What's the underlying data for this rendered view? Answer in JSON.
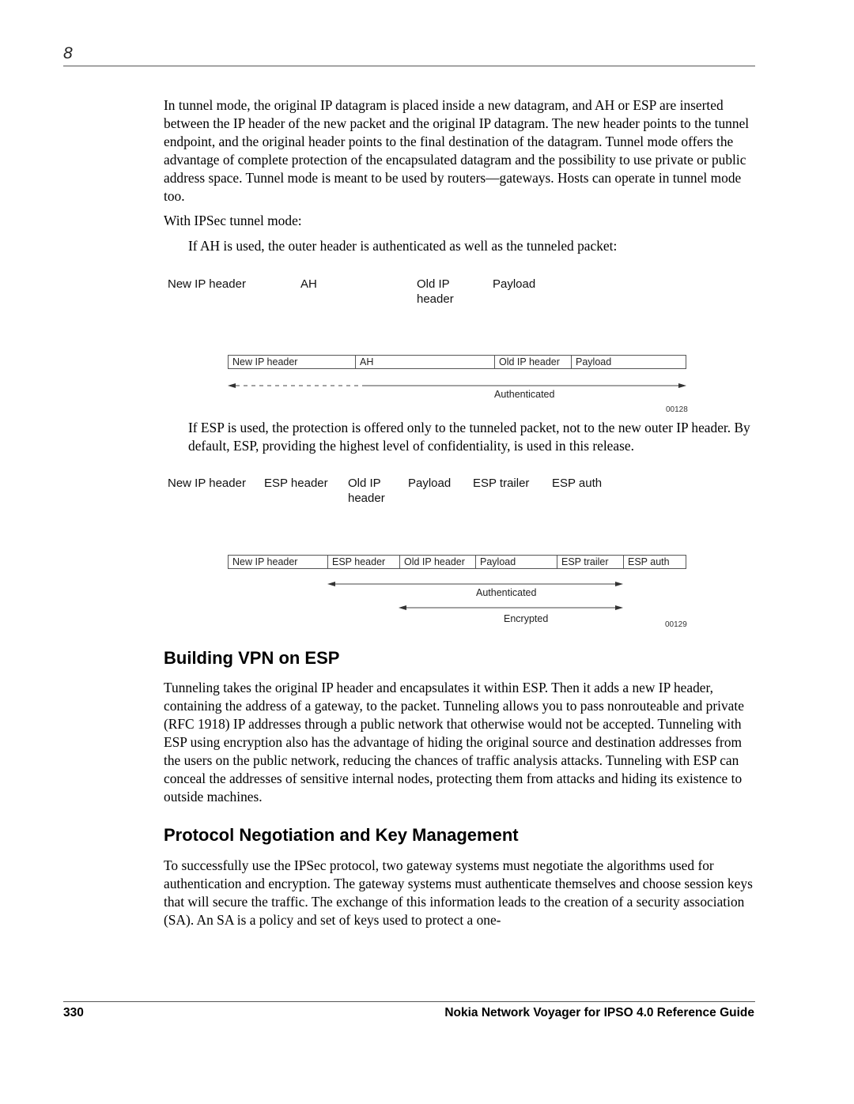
{
  "header": {
    "chapter_number": "8"
  },
  "body": {
    "intro_paragraph": "In tunnel mode, the original IP datagram is placed inside a new datagram, and AH or ESP are inserted between the IP header of the new packet and the original IP datagram. The new header points to the tunnel endpoint, and the original header points to the final destination of the datagram. Tunnel mode offers the advantage of complete protection of the encapsulated datagram and the possibility to use private or public address space. Tunnel mode is meant to be used by routers—gateways. Hosts can operate in tunnel mode too.",
    "tunnel_mode_lead": "With IPSec tunnel mode:",
    "ah_paragraph": "If AH is used, the outer header is authenticated as well as the tunneled packet:",
    "esp_paragraph": "If ESP is used, the protection is offered only to the tunneled packet, not to the new outer IP header. By default, ESP, providing the highest level of confidentiality, is used in this release."
  },
  "ah_diagram": {
    "column_labels": [
      "New IP header",
      "AH",
      "Old IP header",
      "Payload"
    ],
    "column_labels_wrapped": [
      "New IP header",
      "AH",
      "Old IP\nheader",
      "Payload"
    ],
    "packet_cells": [
      "New IP header",
      "AH",
      "Old IP header",
      "Payload"
    ],
    "arrow_label": "Authenticated",
    "figure_id": "00128"
  },
  "esp_diagram": {
    "column_labels": [
      "New IP header",
      "ESP header",
      "Old IP header",
      "Payload",
      "ESP trailer",
      "ESP auth"
    ],
    "packet_cells": [
      "New IP header",
      "ESP header",
      "Old IP header",
      "Payload",
      "ESP trailer",
      "ESP auth"
    ],
    "authenticated_label": "Authenticated",
    "encrypted_label": "Encrypted",
    "figure_id": "00129"
  },
  "sections": [
    {
      "heading": "Building VPN on ESP",
      "text": "Tunneling takes the original IP header and encapsulates it within ESP. Then it adds a new IP header, containing the address of a gateway, to the packet. Tunneling allows you to pass nonrouteable and private (RFC 1918) IP addresses through a public network that otherwise would not be accepted. Tunneling with ESP using encryption also has the advantage of hiding the original source and destination addresses from the users on the public network, reducing the chances of traffic analysis attacks. Tunneling with ESP can conceal the addresses of sensitive internal nodes, protecting them from attacks and hiding its existence to outside machines."
    },
    {
      "heading": "Protocol Negotiation and Key Management",
      "text": "To successfully use the IPSec protocol, two gateway systems must negotiate the algorithms used for authentication and encryption. The gateway systems must authenticate themselves and choose session keys that will secure the traffic. The exchange of this information leads to the creation of a security association (SA). An SA is a policy and set of keys used to protect a one-"
    }
  ],
  "footer": {
    "page_number": "330",
    "book_title": "Nokia Network Voyager for IPSO 4.0 Reference Guide"
  }
}
